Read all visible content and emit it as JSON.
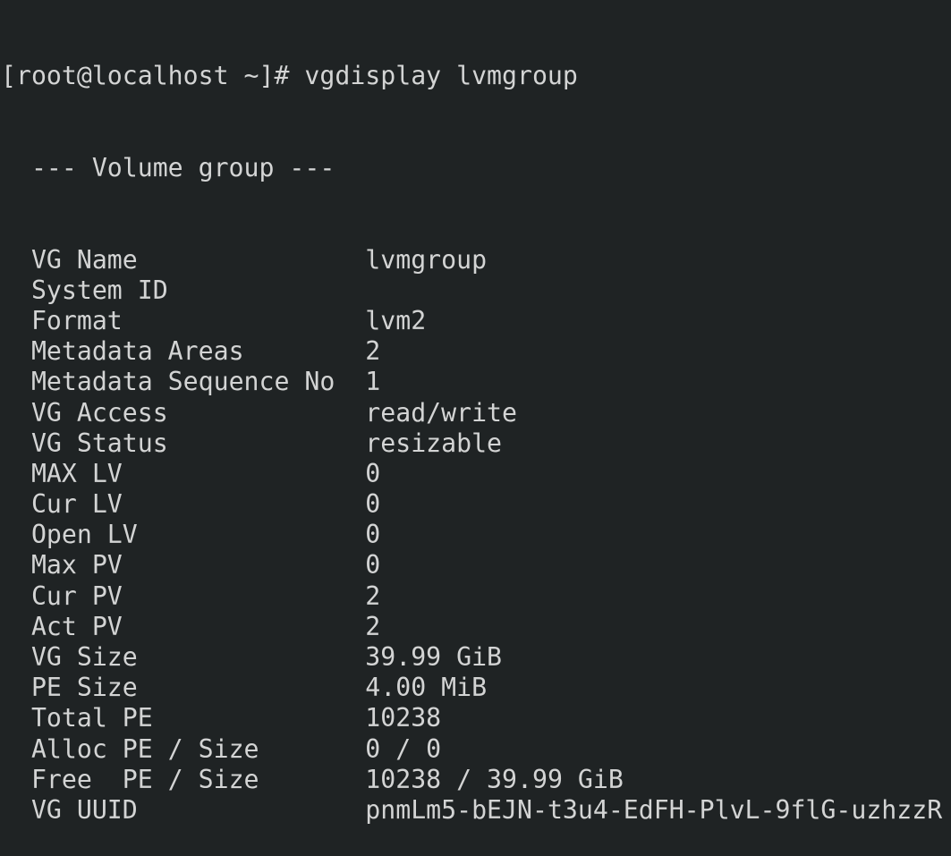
{
  "terminal": {
    "prompt": "[root@localhost ~]# ",
    "command": "vgdisplay lvmgroup",
    "header": "  --- Volume group ---",
    "rows": [
      {
        "label": "VG Name",
        "value": "lvmgroup"
      },
      {
        "label": "System ID",
        "value": ""
      },
      {
        "label": "Format",
        "value": "lvm2"
      },
      {
        "label": "Metadata Areas",
        "value": "2"
      },
      {
        "label": "Metadata Sequence No",
        "value": "1"
      },
      {
        "label": "VG Access",
        "value": "read/write"
      },
      {
        "label": "VG Status",
        "value": "resizable"
      },
      {
        "label": "MAX LV",
        "value": "0"
      },
      {
        "label": "Cur LV",
        "value": "0"
      },
      {
        "label": "Open LV",
        "value": "0"
      },
      {
        "label": "Max PV",
        "value": "0"
      },
      {
        "label": "Cur PV",
        "value": "2"
      },
      {
        "label": "Act PV",
        "value": "2"
      },
      {
        "label": "VG Size",
        "value": "39.99 GiB"
      },
      {
        "label": "PE Size",
        "value": "4.00 MiB"
      },
      {
        "label": "Total PE",
        "value": "10238"
      },
      {
        "label": "Alloc PE / Size",
        "value": "0 / 0"
      },
      {
        "label": "Free  PE / Size",
        "value": "10238 / 39.99 GiB"
      },
      {
        "label": "VG UUID",
        "value": "pnmLm5-bEJN-t3u4-EdFH-PlvL-9flG-uzhzzR"
      }
    ]
  }
}
